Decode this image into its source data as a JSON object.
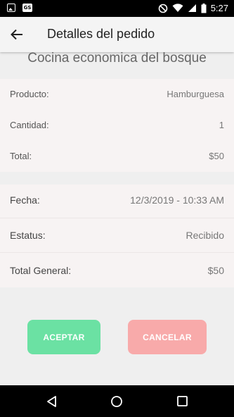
{
  "status_bar": {
    "time": "5:27",
    "icons": [
      "image-icon",
      "gs-icon",
      "do-not-disturb-icon",
      "wifi-icon",
      "signal-icon",
      "battery-icon"
    ],
    "gs_label": "GS"
  },
  "app_bar": {
    "title": "Detalles del pedido",
    "back_icon": "arrow-back-icon"
  },
  "restaurant_name": "Cocina economica del bosque",
  "order_items": [
    {
      "label": "Producto:",
      "value": "Hamburguesa"
    },
    {
      "label": "Cantidad:",
      "value": "1"
    },
    {
      "label": "Total:",
      "value": "$50"
    }
  ],
  "summary": [
    {
      "label": "Fecha:",
      "value": "12/3/2019 - 10:33 AM"
    },
    {
      "label": "Estatus:",
      "value": "Recibido"
    },
    {
      "label": "Total General:",
      "value": "$50"
    }
  ],
  "buttons": {
    "accept_label": "ACEPTAR",
    "cancel_label": "CANCELAR"
  },
  "nav_bar": {
    "icons": [
      "back-triangle-icon",
      "home-circle-icon",
      "recents-square-icon"
    ]
  },
  "colors": {
    "accept": "#6be1a3",
    "cancel": "#f8aaaa",
    "card": "#f7f3f3",
    "background": "#efefef"
  }
}
